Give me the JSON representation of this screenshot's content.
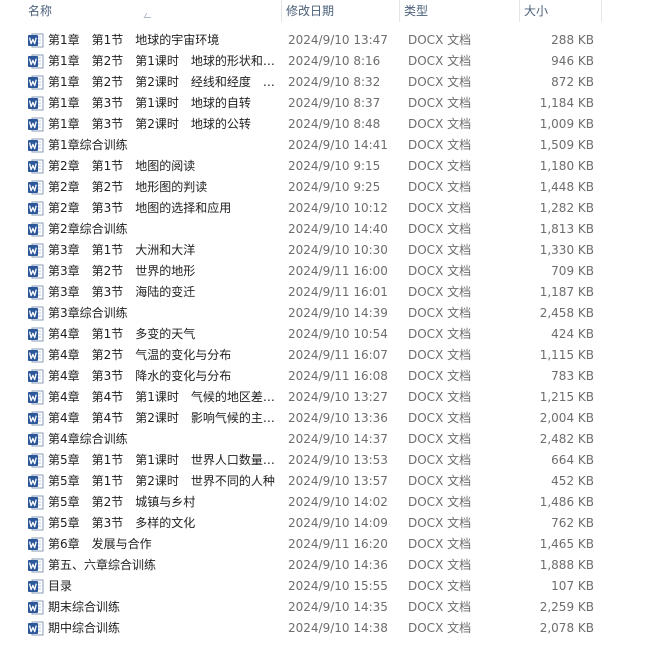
{
  "columns": {
    "name": "名称",
    "date": "修改日期",
    "type": "类型",
    "size": "大小"
  },
  "icon_name": "word-doc-icon",
  "colors": {
    "header_text": "#4c607a",
    "name_text": "#1e1e1e",
    "meta_text": "#6d6d6d",
    "word_blue": "#2b579a"
  },
  "files": [
    {
      "name": "第1章　第1节　地球的宇宙环境",
      "date": "2024/9/10 13:47",
      "type": "DOCX 文档",
      "size": "288 KB"
    },
    {
      "name": "第1章　第2节　第1课时　地球的形状和…",
      "date": "2024/9/10 8:16",
      "type": "DOCX 文档",
      "size": "946 KB"
    },
    {
      "name": "第1章　第2节　第2课时　经线和经度　…",
      "date": "2024/9/10 8:32",
      "type": "DOCX 文档",
      "size": "872 KB"
    },
    {
      "name": "第1章　第3节　第1课时　地球的自转",
      "date": "2024/9/10 8:37",
      "type": "DOCX 文档",
      "size": "1,184 KB"
    },
    {
      "name": "第1章　第3节　第2课时　地球的公转",
      "date": "2024/9/10 8:48",
      "type": "DOCX 文档",
      "size": "1,009 KB"
    },
    {
      "name": "第1章综合训练",
      "date": "2024/9/10 14:41",
      "type": "DOCX 文档",
      "size": "1,509 KB"
    },
    {
      "name": "第2章　第1节　地图的阅读",
      "date": "2024/9/10 9:15",
      "type": "DOCX 文档",
      "size": "1,180 KB"
    },
    {
      "name": "第2章　第2节　地形图的判读",
      "date": "2024/9/10 9:25",
      "type": "DOCX 文档",
      "size": "1,448 KB"
    },
    {
      "name": "第2章　第3节　地图的选择和应用",
      "date": "2024/9/10 10:12",
      "type": "DOCX 文档",
      "size": "1,282 KB"
    },
    {
      "name": "第2章综合训练",
      "date": "2024/9/10 14:40",
      "type": "DOCX 文档",
      "size": "1,813 KB"
    },
    {
      "name": "第3章　第1节　大洲和大洋",
      "date": "2024/9/10 10:30",
      "type": "DOCX 文档",
      "size": "1,330 KB"
    },
    {
      "name": "第3章　第2节　世界的地形",
      "date": "2024/9/11 16:00",
      "type": "DOCX 文档",
      "size": "709 KB"
    },
    {
      "name": "第3章　第3节　海陆的变迁",
      "date": "2024/9/11 16:01",
      "type": "DOCX 文档",
      "size": "1,187 KB"
    },
    {
      "name": "第3章综合训练",
      "date": "2024/9/10 14:39",
      "type": "DOCX 文档",
      "size": "2,458 KB"
    },
    {
      "name": "第4章　第1节　多变的天气",
      "date": "2024/9/10 10:54",
      "type": "DOCX 文档",
      "size": "424 KB"
    },
    {
      "name": "第4章　第2节　气温的变化与分布",
      "date": "2024/9/11 16:07",
      "type": "DOCX 文档",
      "size": "1,115 KB"
    },
    {
      "name": "第4章　第3节　降水的变化与分布",
      "date": "2024/9/11 16:08",
      "type": "DOCX 文档",
      "size": "783 KB"
    },
    {
      "name": "第4章　第4节　第1课时　气候的地区差…",
      "date": "2024/9/10 13:27",
      "type": "DOCX 文档",
      "size": "1,215 KB"
    },
    {
      "name": "第4章　第4节　第2课时　影响气候的主…",
      "date": "2024/9/10 13:36",
      "type": "DOCX 文档",
      "size": "2,004 KB"
    },
    {
      "name": "第4章综合训练",
      "date": "2024/9/10 14:37",
      "type": "DOCX 文档",
      "size": "2,482 KB"
    },
    {
      "name": "第5章　第1节　第1课时　世界人口数量…",
      "date": "2024/9/10 13:53",
      "type": "DOCX 文档",
      "size": "664 KB"
    },
    {
      "name": "第5章　第1节　第2课时　世界不同的人种",
      "date": "2024/9/10 13:57",
      "type": "DOCX 文档",
      "size": "452 KB"
    },
    {
      "name": "第5章　第2节　城镇与乡村",
      "date": "2024/9/10 14:02",
      "type": "DOCX 文档",
      "size": "1,486 KB"
    },
    {
      "name": "第5章　第3节　多样的文化",
      "date": "2024/9/10 14:09",
      "type": "DOCX 文档",
      "size": "762 KB"
    },
    {
      "name": "第6章　发展与合作",
      "date": "2024/9/11 16:20",
      "type": "DOCX 文档",
      "size": "1,465 KB"
    },
    {
      "name": "第五、六章综合训练",
      "date": "2024/9/10 14:36",
      "type": "DOCX 文档",
      "size": "1,888 KB"
    },
    {
      "name": "目录",
      "date": "2024/9/10 15:55",
      "type": "DOCX 文档",
      "size": "107 KB"
    },
    {
      "name": "期末综合训练",
      "date": "2024/9/10 14:35",
      "type": "DOCX 文档",
      "size": "2,259 KB"
    },
    {
      "name": "期中综合训练",
      "date": "2024/9/10 14:38",
      "type": "DOCX 文档",
      "size": "2,078 KB"
    }
  ]
}
